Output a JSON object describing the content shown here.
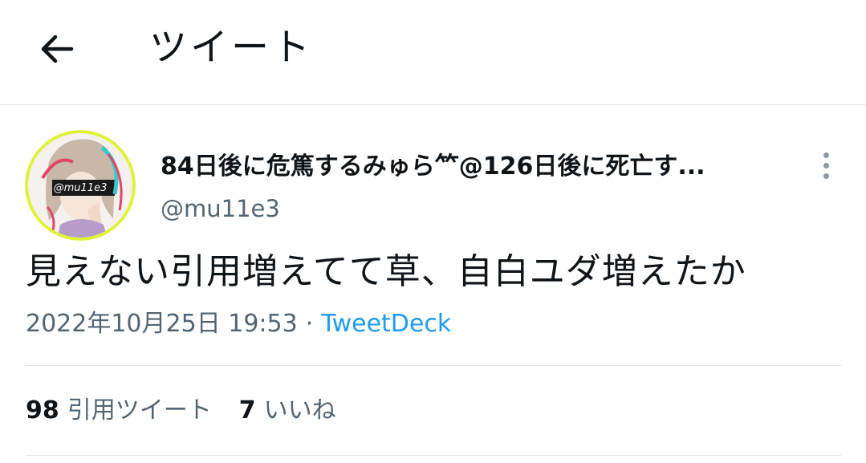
{
  "header": {
    "title": "ツイート"
  },
  "tweet": {
    "display_name": "84日後に危篤するみゅら𥫗@126日後に死亡す...",
    "handle": "@mu11e3",
    "avatar_text": "@mu11e3",
    "text": "見えない引用増えてて草、自白ユダ増えたか",
    "timestamp": "2022年10月25日 19:53",
    "separator": "·",
    "source": "TweetDeck"
  },
  "stats": {
    "quote_count": "98",
    "quote_label": "引用ツイート",
    "like_count": "7",
    "like_label": "いいね"
  },
  "colors": {
    "accent": "#1d9bf0",
    "secondary_text": "#536471",
    "divider": "#e3e6e8"
  }
}
